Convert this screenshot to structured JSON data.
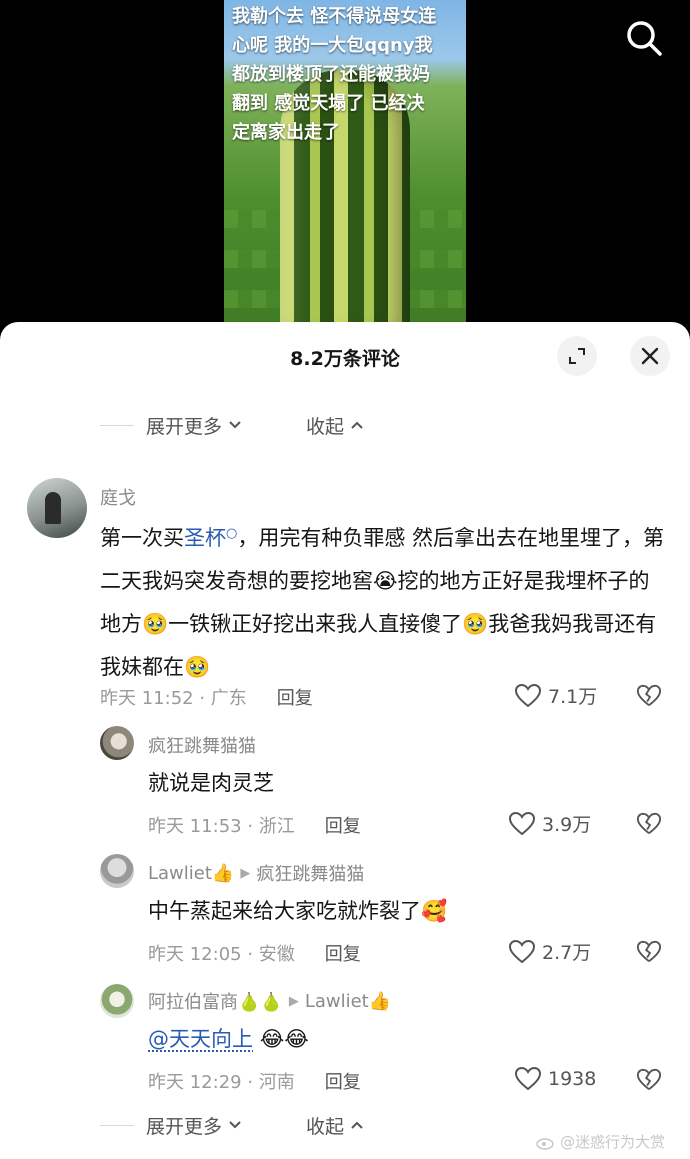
{
  "video": {
    "caption": "我勒个去 怪不得说母女连心呢 我的一大包qqny我都放到楼顶了还能被我妈翻到 感觉天塌了 已经决定离家出走了"
  },
  "sheet": {
    "title": "8.2万条评论",
    "expand_more_label": "展开更多",
    "collapse_label": "收起"
  },
  "comments": [
    {
      "username": "庭戈",
      "text_before": "第一次买",
      "link_word": "圣杯",
      "text_after": "，用完有种负罪感 然后拿出去在地里埋了，第二天我妈突发奇想的要挖地窖😭挖的地方正好是我埋杯子的地方🥹一铁锹正好挖出来我人直接傻了🥹我爸我妈我哥还有我妹都在🥹",
      "time_location": "昨天 11:52 · 广东",
      "reply_label": "回复",
      "likes": "7.1万"
    }
  ],
  "replies": [
    {
      "username": "疯狂跳舞猫猫",
      "reply_to": "",
      "text": "就说是肉灵芝",
      "time_location": "昨天 11:53 · 浙江",
      "reply_label": "回复",
      "likes": "3.9万"
    },
    {
      "username": "Lawliet👍",
      "reply_to": "疯狂跳舞猫猫",
      "text": "中午蒸起来给大家吃就炸裂了🥰",
      "time_location": "昨天 12:05 · 安徽",
      "reply_label": "回复",
      "likes": "2.7万"
    },
    {
      "username": "阿拉伯富商🍐🍐",
      "reply_to": "Lawliet👍",
      "mention": "@天天向上",
      "text": "😂😂",
      "time_location": "昨天 12:29 · 河南",
      "reply_label": "回复",
      "likes": "1938"
    }
  ],
  "watermark": "@迷惑行为大赏",
  "colors": {
    "link": "#2a5bb3",
    "muted": "#9a9a9a",
    "text": "#161616"
  },
  "icons": [
    "search-icon",
    "expand-icon",
    "close-icon",
    "chevron-down-icon",
    "chevron-up-icon",
    "heart-icon",
    "broken-heart-icon",
    "play-arrow-icon",
    "weibo-icon"
  ]
}
